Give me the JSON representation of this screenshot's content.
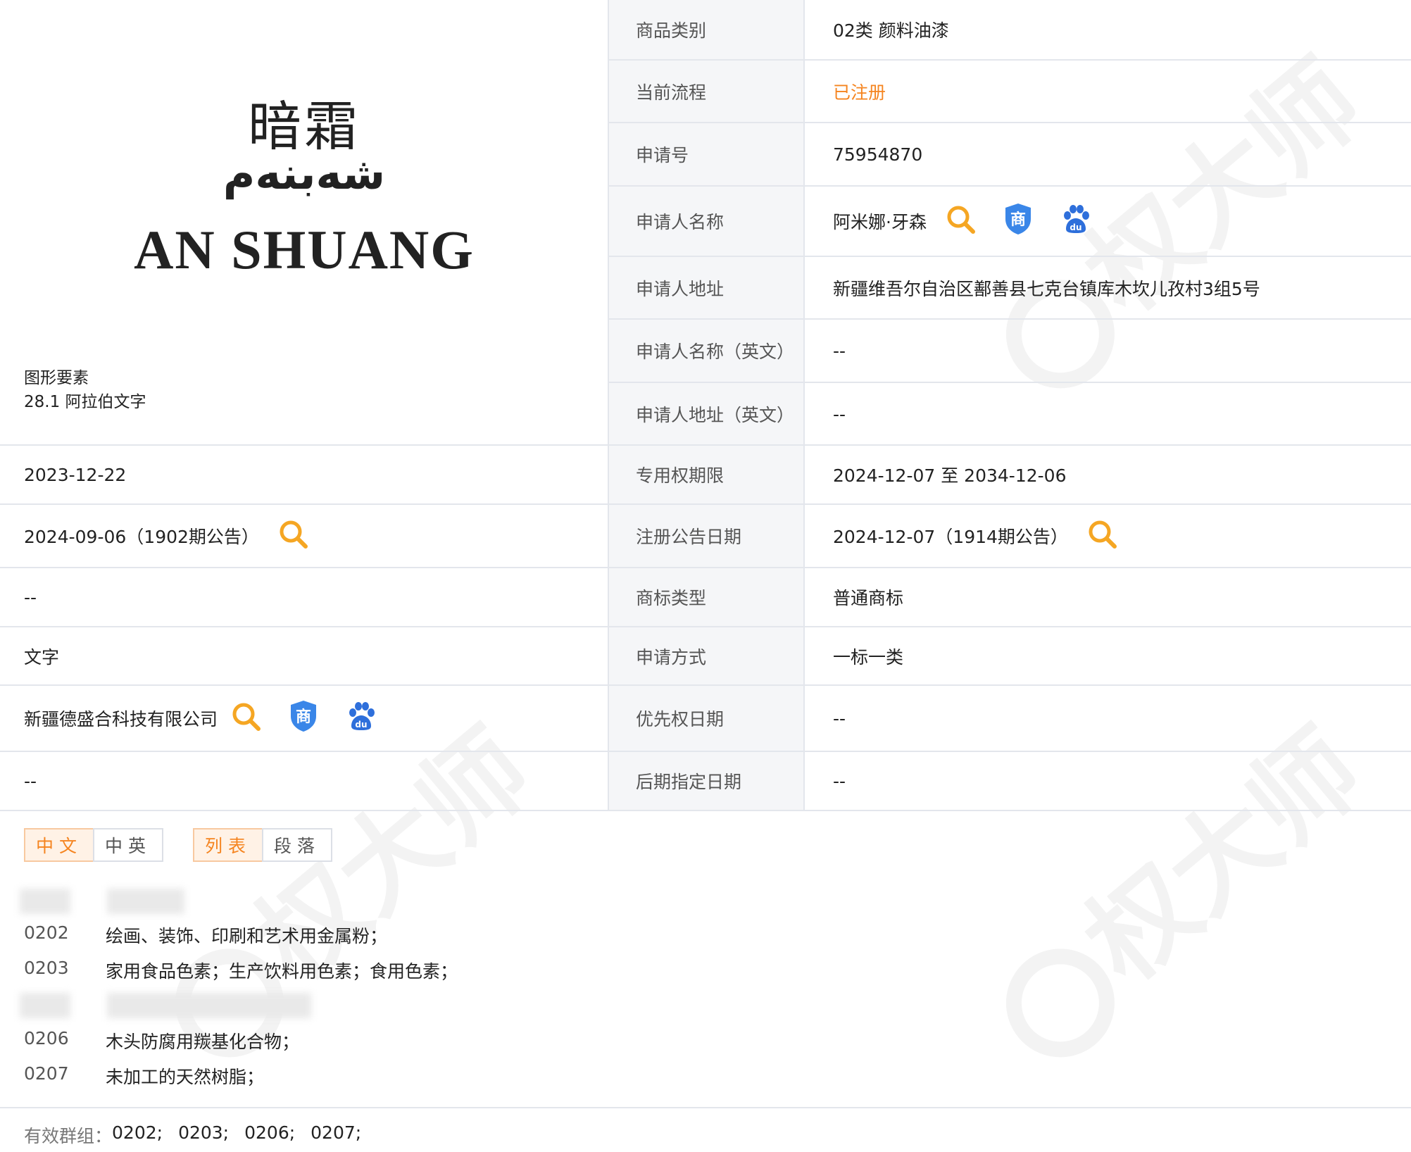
{
  "logo": {
    "chinese": "暗霜",
    "uyghur": "شەبنەم",
    "english": "AN SHUANG"
  },
  "figure": {
    "title": "图形要素",
    "element": "28.1 阿拉伯文字"
  },
  "watermark": "权大师",
  "rows": [
    {
      "label": "商品类别",
      "value": "02类 颜料油漆"
    },
    {
      "label": "当前流程",
      "value": "已注册",
      "value_color": "#f5841f"
    },
    {
      "label": "申请号",
      "value": "75954870"
    },
    {
      "label": "申请人名称",
      "value": "阿米娜·牙森",
      "icons": [
        "search-icon",
        "trademark-shield-icon",
        "baidu-paw-icon"
      ]
    },
    {
      "label": "申请人地址",
      "value": "新疆维吾尔自治区鄯善县七克台镇库木坎儿孜村3组5号"
    },
    {
      "label": "申请人名称（英文）",
      "value": "--"
    },
    {
      "label": "申请人地址（英文）",
      "value": "--"
    },
    {
      "label": "专用权期限",
      "value": "2024-12-07 至 2034-12-06",
      "left": "2023-12-22"
    },
    {
      "label": "注册公告日期",
      "value": "2024-12-07（1914期公告）",
      "left": "2024-09-06（1902期公告）"
    },
    {
      "label": "商标类型",
      "value": "普通商标",
      "left": "--"
    },
    {
      "label": "申请方式",
      "value": "一标一类",
      "left": "文字"
    },
    {
      "label": "优先权日期",
      "value": "--",
      "left": "新疆德盛合科技有限公司"
    },
    {
      "label": "后期指定日期",
      "value": "--",
      "left": "--"
    }
  ],
  "tabs": {
    "lang": [
      "中文",
      "中英"
    ],
    "view": [
      "列表",
      "段落"
    ]
  },
  "goods": [
    {
      "code": "0202",
      "text": "绘画、装饰、印刷和艺术用金属粉；"
    },
    {
      "code": "0203",
      "text": "家用食品色素；生产饮料用色素；食用色素；"
    },
    {
      "code": "0206",
      "text": "木头防腐用羰基化合物；"
    },
    {
      "code": "0207",
      "text": "未加工的天然树脂；"
    }
  ],
  "valid_groups": {
    "label": "有效群组：",
    "codes": [
      "0202;",
      "0203;",
      "0206;",
      "0207;"
    ]
  },
  "colors": {
    "accent": "#f5841f",
    "icon_blue": "#3a86e8",
    "border": "#e3e6ec",
    "label_bg": "#f5f6f8"
  }
}
